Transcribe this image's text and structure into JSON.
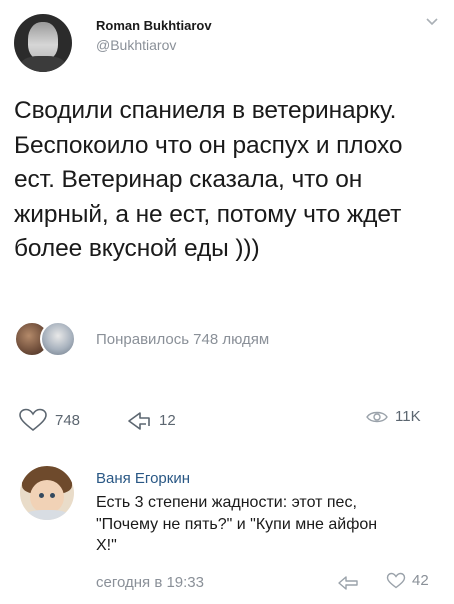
{
  "header": {
    "name": "Roman Bukhtiarov",
    "handle": "@Bukhtiarov"
  },
  "tweet": {
    "text": "Сводили спаниеля в ветеринарку. Беспокоило что он распух и плохо ест. Ветеринар сказала, что он жирный, а не ест, потому что ждет более вкусной еды )))"
  },
  "likes": {
    "text": "Понравилось 748 людям"
  },
  "actions": {
    "likes_count": "748",
    "shares_count": "12",
    "views_count": "11K"
  },
  "comment": {
    "author": "Ваня Егоркин",
    "text": "Есть 3 степени жадности: этот пес, \"Почему не пять?\" и \"Купи мне айфон Х!\"",
    "time": "сегодня в 19:33",
    "likes_count": "42"
  },
  "colors": {
    "text": "#1a1a1a",
    "muted": "#8a9098",
    "link": "#2a5885",
    "icon": "#5c6670"
  },
  "icons": [
    "chevron-down-icon",
    "heart-icon",
    "share-icon",
    "eye-icon",
    "reply-icon"
  ]
}
